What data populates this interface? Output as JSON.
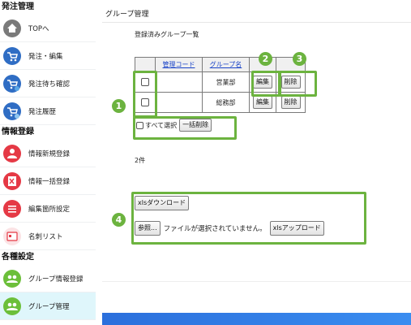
{
  "sidebar": {
    "sections": [
      {
        "title": "発注管理",
        "items": [
          {
            "label": "TOPへ",
            "icon": "home-icon"
          },
          {
            "label": "発注・編集",
            "icon": "cart-icon"
          },
          {
            "label": "発注待ち確認",
            "icon": "cart-pending-icon"
          },
          {
            "label": "発注履歴",
            "icon": "cart-history-icon"
          }
        ]
      },
      {
        "title": "情報登録",
        "items": [
          {
            "label": "情報新規登録",
            "icon": "user-add-icon"
          },
          {
            "label": "情報一括登録",
            "icon": "excel-import-icon"
          },
          {
            "label": "編集箇所設定",
            "icon": "list-settings-icon"
          },
          {
            "label": "名刺リスト",
            "icon": "business-card-icon"
          }
        ]
      },
      {
        "title": "各種設定",
        "items": [
          {
            "label": "グループ情報登録",
            "icon": "group-register-icon"
          },
          {
            "label": "グループ管理",
            "icon": "group-manage-icon",
            "active": true
          }
        ]
      }
    ]
  },
  "main": {
    "title": "グループ管理",
    "subtitle": "登録済みグループ一覧",
    "table": {
      "headers": [
        "",
        "管理コード",
        "グループ名",
        "",
        ""
      ],
      "rows": [
        {
          "code": "",
          "name": "営業部",
          "edit": "編集",
          "delete": "削除"
        },
        {
          "code": "",
          "name": "総務部",
          "edit": "編集",
          "delete": "削除"
        }
      ]
    },
    "select_all_label": "すべて選択",
    "bulk_delete_label": "一括削除",
    "count": "2件",
    "download_label": "xlsダウンロード",
    "browse_label": "参照...",
    "file_status": "ファイルが選択されていません。",
    "upload_label": "xlsアップロード"
  },
  "callouts": [
    "1",
    "2",
    "3",
    "4"
  ],
  "colors": {
    "highlight": "#6cb33f",
    "active_bg": "#dff6fb",
    "bottom_bar": "#2b6fdc",
    "link": "#1a44c8"
  }
}
